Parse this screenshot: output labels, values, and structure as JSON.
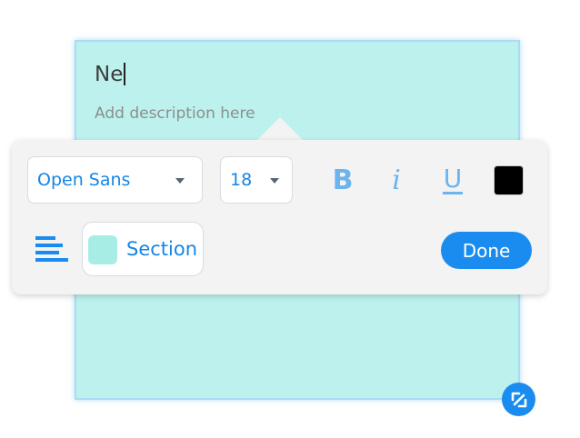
{
  "card": {
    "title": "Ne",
    "description_placeholder": "Add description here",
    "background_color": "#bdf1ed"
  },
  "toolbar": {
    "font_family": "Open Sans",
    "font_size": "18",
    "bold_label": "B",
    "italic_label": "i",
    "underline_label": "U",
    "text_color": "#000000",
    "section_label": "Section",
    "section_color": "#a8ece6",
    "done_label": "Done"
  },
  "icons": [
    "chevron-down-icon",
    "align-left-icon",
    "resize-icon"
  ],
  "colors": {
    "accent": "#1a8cef",
    "muted_accent": "#6cb4ee"
  }
}
